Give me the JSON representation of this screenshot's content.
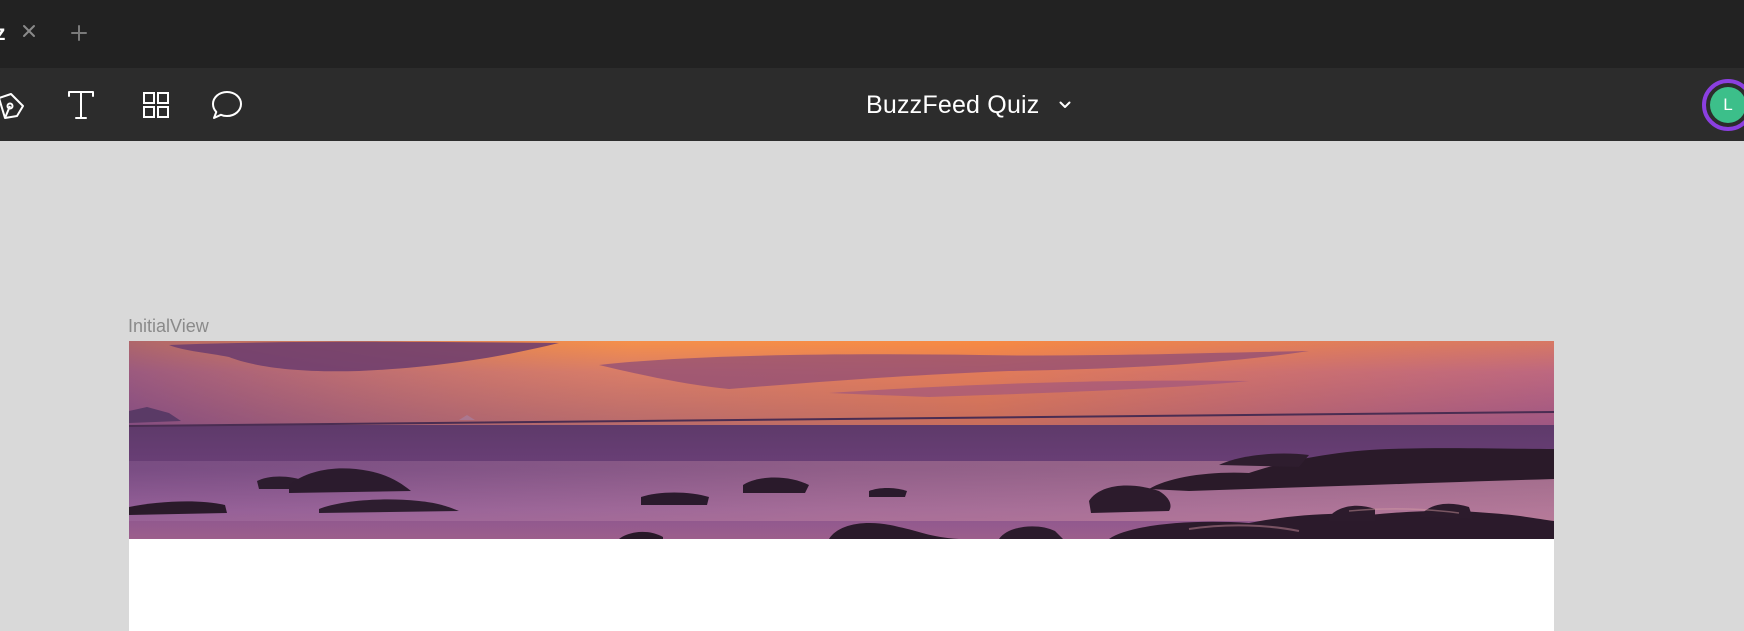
{
  "tabbar": {
    "tab_title": "z",
    "close_icon": "close-icon",
    "add_icon": "plus-icon"
  },
  "toolbar": {
    "tools": [
      {
        "name": "pen-tool",
        "icon": "pen-icon"
      },
      {
        "name": "text-tool",
        "icon": "text-icon"
      },
      {
        "name": "components-tool",
        "icon": "grid-icon"
      },
      {
        "name": "comment-tool",
        "icon": "comment-icon"
      }
    ],
    "document_title": "BuzzFeed Quiz",
    "chevron_icon": "chevron-down-icon",
    "avatar_initial": "L",
    "avatar_color": "#3cbf8a",
    "avatar_ring_color": "#8b3fe0"
  },
  "canvas": {
    "frame_label": "InitialView",
    "hero_image": "sunset-sea-rocks-image"
  },
  "colors": {
    "tabbar_bg": "#222222",
    "toolbar_bg": "#2c2c2c",
    "canvas_bg": "#d9d9d9"
  }
}
